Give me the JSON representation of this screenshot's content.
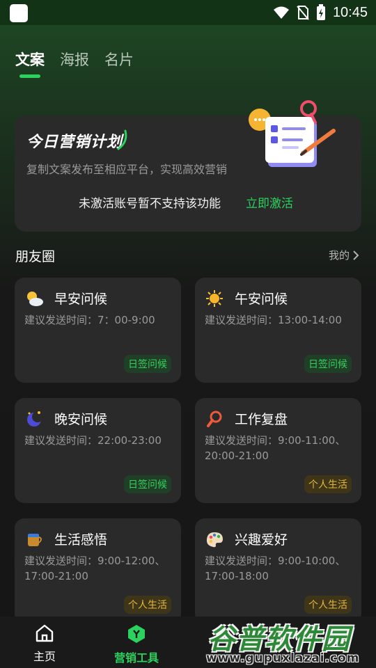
{
  "status_bar": {
    "time": "10:45"
  },
  "tabs": [
    {
      "label": "文案",
      "active": true
    },
    {
      "label": "海报",
      "active": false
    },
    {
      "label": "名片",
      "active": false
    }
  ],
  "plan": {
    "title": "今日营销计划",
    "subtitle": "复制文案发布至相应平台，实现高效营销",
    "notice": "未激活账号暂不支持该功能",
    "activate_label": "立即激活"
  },
  "section": {
    "title": "朋友圈",
    "mine_label": "我的"
  },
  "cards": [
    {
      "icon": "cloud-sun-icon",
      "title": "早安问候",
      "desc": "建议发送时间：7：00-9:00",
      "badge": "日签问候",
      "badge_color": "green"
    },
    {
      "icon": "sun-icon",
      "title": "午安问候",
      "desc": "建议发送时间：13:00-14:00",
      "badge": "日签问候",
      "badge_color": "green"
    },
    {
      "icon": "moon-icon",
      "title": "晚安问候",
      "desc": "建议发送时间：22:00-23:00",
      "badge": "日签问候",
      "badge_color": "green"
    },
    {
      "icon": "magnifier-icon",
      "title": "工作复盘",
      "desc": "建议发送时间：9:00-11:00、20:00-21:00",
      "badge": "个人生活",
      "badge_color": "yellow"
    },
    {
      "icon": "coffee-icon",
      "title": "生活感悟",
      "desc": "建议发送时间：9:00-12:00、17:00-21:00",
      "badge": "个人生活",
      "badge_color": "yellow"
    },
    {
      "icon": "palette-icon",
      "title": "兴趣爱好",
      "desc": "建议发送时间：9:00-10:00、17:00-18:00",
      "badge": "个人生活",
      "badge_color": "yellow"
    }
  ],
  "bottom_nav": [
    {
      "label": "主页",
      "icon": "home-icon",
      "active": false
    },
    {
      "label": "营销工具",
      "icon": "marketing-tools-icon",
      "active": true
    }
  ],
  "watermark": {
    "title": "谷普软件园",
    "url": "www.gupuxlazai.com"
  },
  "colors": {
    "accent": "#2bd25d",
    "card_bg": "#2a2a2a",
    "badge_yellow": "#e6b93b"
  }
}
